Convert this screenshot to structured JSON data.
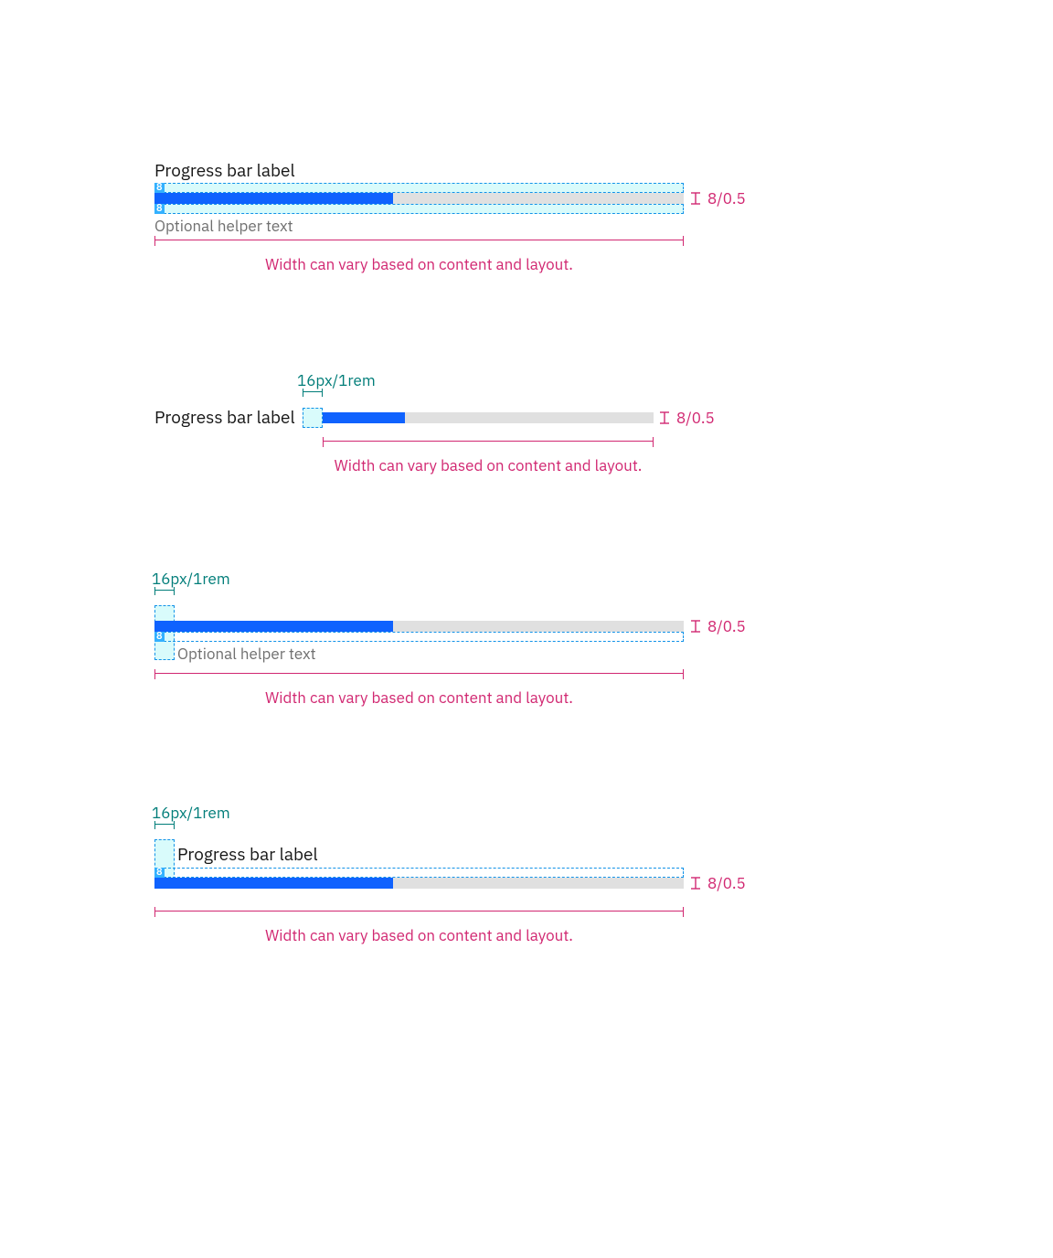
{
  "colors": {
    "track": "#e0e0e0",
    "fill": "#0f62fe",
    "cyan_fill": "#d9fbfb",
    "cyan_dash": "#1192e8",
    "teal": "#007d79",
    "magenta": "#d12771",
    "text": "#161616",
    "helper": "#6f6f6f"
  },
  "common": {
    "label": "Progress bar label",
    "helper": "Optional helper text",
    "width_caption": "Width can vary based on content and layout.",
    "spacer_tag": "8",
    "height_note": "8/0.5",
    "spacing_note": "16px/1rem"
  },
  "specs": [
    {
      "id": "v1",
      "variant": "default-with-helper"
    },
    {
      "id": "v2",
      "variant": "inline-label-left"
    },
    {
      "id": "v3",
      "variant": "helper-only-indented"
    },
    {
      "id": "v4",
      "variant": "label-only-indented"
    }
  ],
  "progress_percent": 45
}
